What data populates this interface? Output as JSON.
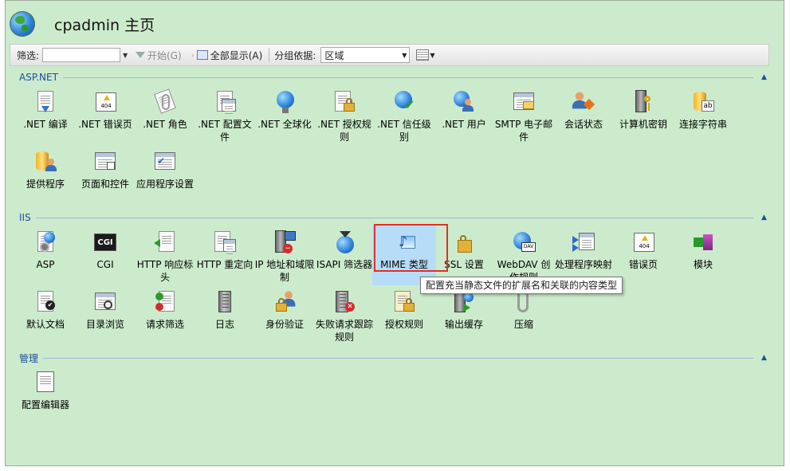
{
  "header": {
    "title": "cpadmin 主页"
  },
  "toolbar": {
    "filter_label": "筛选:",
    "filter_value": "",
    "start_label": "开始(G)",
    "show_all_label": "全部显示(A)",
    "group_by_label": "分组依据:",
    "group_by_value": "区域"
  },
  "sections": {
    "aspnet": {
      "title": "ASP.NET",
      "items": [
        {
          "label": ".NET 编译",
          "icon": "dotnet-compile-icon"
        },
        {
          "label": ".NET 错误页",
          "icon": "dotnet-error-pages-icon"
        },
        {
          "label": ".NET 角色",
          "icon": "dotnet-roles-icon"
        },
        {
          "label": ".NET 配置文件",
          "icon": "dotnet-profile-icon"
        },
        {
          "label": ".NET 全球化",
          "icon": "dotnet-globalization-icon"
        },
        {
          "label": ".NET 授权规则",
          "icon": "dotnet-authorization-icon"
        },
        {
          "label": ".NET 信任级别",
          "icon": "dotnet-trust-level-icon"
        },
        {
          "label": ".NET 用户",
          "icon": "dotnet-users-icon"
        },
        {
          "label": "SMTP 电子邮件",
          "icon": "smtp-email-icon"
        },
        {
          "label": "会话状态",
          "icon": "session-state-icon"
        },
        {
          "label": "计算机密钥",
          "icon": "machine-key-icon"
        },
        {
          "label": "连接字符串",
          "icon": "connection-strings-icon"
        },
        {
          "label": "提供程序",
          "icon": "providers-icon"
        },
        {
          "label": "页面和控件",
          "icon": "pages-controls-icon"
        },
        {
          "label": "应用程序设置",
          "icon": "app-settings-icon"
        }
      ]
    },
    "iis": {
      "title": "IIS",
      "items": [
        {
          "label": "ASP",
          "icon": "asp-icon"
        },
        {
          "label": "CGI",
          "icon": "cgi-icon"
        },
        {
          "label": "HTTP 响应标头",
          "icon": "http-response-headers-icon"
        },
        {
          "label": "HTTP 重定向",
          "icon": "http-redirect-icon"
        },
        {
          "label": "IP 地址和域限制",
          "icon": "ip-domain-restrictions-icon"
        },
        {
          "label": "ISAPI 筛选器",
          "icon": "isapi-filters-icon"
        },
        {
          "label": "MIME 类型",
          "icon": "mime-types-icon"
        },
        {
          "label": "SSL 设置",
          "icon": "ssl-settings-icon"
        },
        {
          "label": "WebDAV 创作规则",
          "icon": "webdav-authoring-icon"
        },
        {
          "label": "处理程序映射",
          "icon": "handler-mappings-icon"
        },
        {
          "label": "错误页",
          "icon": "error-pages-icon"
        },
        {
          "label": "模块",
          "icon": "modules-icon"
        },
        {
          "label": "默认文档",
          "icon": "default-document-icon"
        },
        {
          "label": "目录浏览",
          "icon": "directory-browsing-icon"
        },
        {
          "label": "请求筛选",
          "icon": "request-filtering-icon"
        },
        {
          "label": "日志",
          "icon": "logging-icon"
        },
        {
          "label": "身份验证",
          "icon": "authentication-icon"
        },
        {
          "label": "失败请求跟踪规则",
          "icon": "failed-request-tracing-icon"
        },
        {
          "label": "授权规则",
          "icon": "authorization-rules-icon"
        },
        {
          "label": "输出缓存",
          "icon": "output-caching-icon"
        },
        {
          "label": "压缩",
          "icon": "compression-icon"
        }
      ]
    },
    "management": {
      "title": "管理",
      "items": [
        {
          "label": "配置编辑器",
          "icon": "configuration-editor-icon"
        }
      ]
    }
  },
  "tooltip": {
    "text": "配置充当静态文件的扩展名和关联的内容类型"
  },
  "colors": {
    "background": "#ccebcc",
    "section_title": "#1a4e9a",
    "highlight": "#e0302a",
    "selected": "#b6dcf7"
  }
}
